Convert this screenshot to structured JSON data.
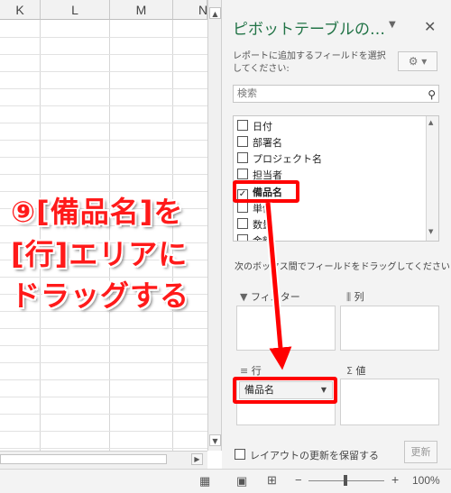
{
  "sheet": {
    "columns": [
      "K",
      "L",
      "M",
      "N"
    ]
  },
  "pivot_panel": {
    "title": "ピボットテーブルの…",
    "subtitle": "レポートに追加するフィールドを選択してください:",
    "search_placeholder": "検索",
    "fields": [
      {
        "label": "日付",
        "checked": false
      },
      {
        "label": "部署名",
        "checked": false
      },
      {
        "label": "プロジェクト名",
        "checked": false
      },
      {
        "label": "担当者",
        "checked": false
      },
      {
        "label": "備品名",
        "checked": true
      },
      {
        "label": "単価",
        "checked": false
      },
      {
        "label": "数量",
        "checked": false
      },
      {
        "label": "金額",
        "checked": false
      }
    ],
    "drag_instruction": "次のボックス間でフィールドをドラッグしてください:",
    "areas": {
      "filter": "フィルター",
      "columns": "列",
      "rows": "行",
      "values": "値"
    },
    "row_field": "備品名",
    "defer_label": "レイアウトの更新を保留する",
    "update_button": "更新"
  },
  "annotation": {
    "line1": "⑨[備品名]を",
    "line2": "[行]エリアに",
    "line3": "ドラッグする",
    "color": "#ff0000"
  },
  "statusbar": {
    "zoom": "100%"
  }
}
